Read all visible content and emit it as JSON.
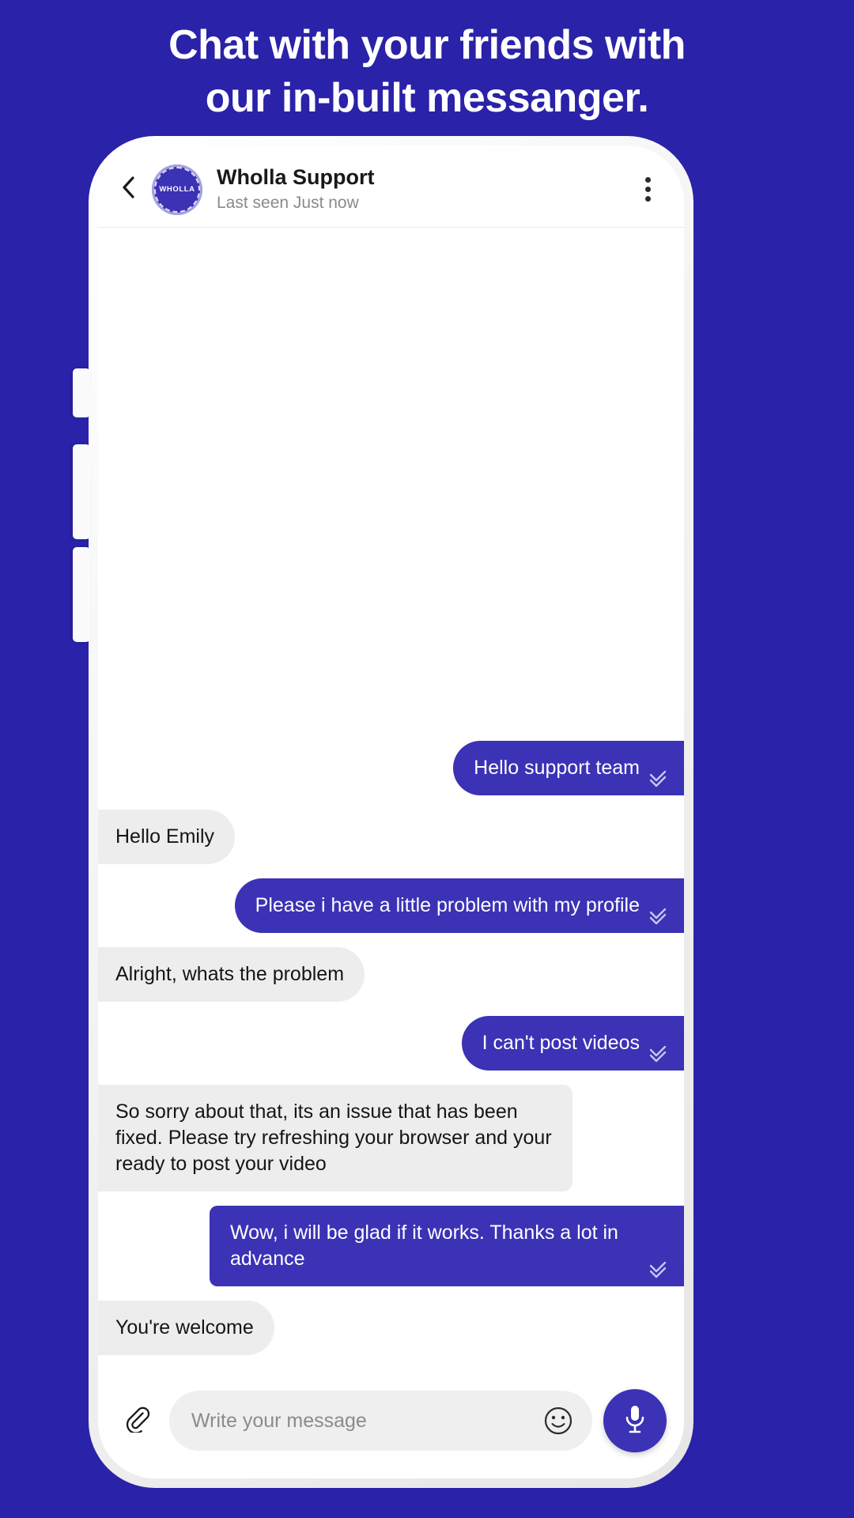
{
  "promo": {
    "headline_line1": "Chat with your friends with",
    "headline_line2": "our in-built messanger.",
    "background_color": "#2A22A8"
  },
  "chat_header": {
    "back_icon": "chevron-left-icon",
    "avatar_label": "WHOLLA",
    "title": "Wholla Support",
    "subtitle": "Last seen Just now",
    "menu_icon": "kebab-menu-icon"
  },
  "messages": [
    {
      "id": 1,
      "direction": "out",
      "text": "Hello support team",
      "shape": "pill",
      "status": "read"
    },
    {
      "id": 2,
      "direction": "in",
      "text": "Hello Emily",
      "shape": "pill",
      "status": ""
    },
    {
      "id": 3,
      "direction": "out",
      "text": "Please i have a little problem with my profile",
      "shape": "pill",
      "status": "read"
    },
    {
      "id": 4,
      "direction": "in",
      "text": "Alright, whats the problem",
      "shape": "pill",
      "status": ""
    },
    {
      "id": 5,
      "direction": "out",
      "text": "I can't post videos",
      "shape": "pill",
      "status": "read"
    },
    {
      "id": 6,
      "direction": "in",
      "text": "So sorry about that, its an issue that has been fixed. Please try refreshing your browser and your ready to post your video",
      "shape": "boxy",
      "status": ""
    },
    {
      "id": 7,
      "direction": "out",
      "text": "Wow, i will be glad if it works. Thanks a lot in advance",
      "shape": "boxy",
      "status": "read"
    },
    {
      "id": 8,
      "direction": "in",
      "text": "You're welcome",
      "shape": "pill",
      "status": ""
    }
  ],
  "composer": {
    "attach_icon": "paperclip-icon",
    "placeholder": "Write your message",
    "emoji_icon": "smiley-face-icon",
    "mic_icon": "microphone-icon"
  },
  "colors": {
    "brand_blue": "#2A22A8",
    "bubble_out": "#3B32B5",
    "bubble_in": "#EDEDED",
    "text_dark": "#151515",
    "text_muted": "#8A8A8A"
  }
}
